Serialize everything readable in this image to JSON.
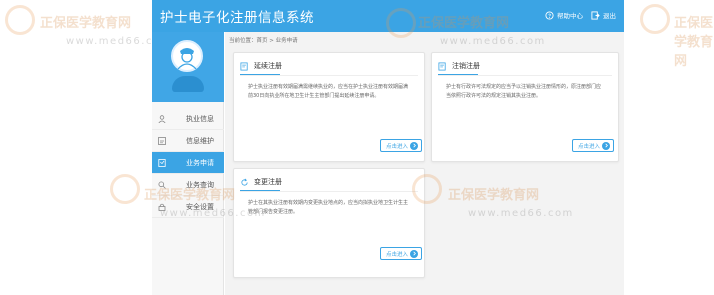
{
  "header": {
    "title": "护士电子化注册信息系统",
    "help_label": "帮助中心",
    "logout_label": "退出"
  },
  "sidebar": {
    "items": [
      {
        "label": "执业信息",
        "icon": "user-icon",
        "active": false
      },
      {
        "label": "信息维护",
        "icon": "edit-icon",
        "active": false
      },
      {
        "label": "业务申请",
        "icon": "document-icon",
        "active": true
      },
      {
        "label": "业务查询",
        "icon": "search-icon",
        "active": false
      },
      {
        "label": "安全设置",
        "icon": "lock-icon",
        "active": false
      }
    ]
  },
  "breadcrumb": "当前位置：首页 > 业务申请",
  "cards": {
    "renew": {
      "title": "延续注册",
      "description": "护士执业注册有效期届满需继续执业的，应当在护士执业注册有效期届满前30日向执业所在地卫生计生主管部门提出延续注册申请。",
      "button": "点击进入"
    },
    "cancel": {
      "title": "注销注册",
      "description": "护士有行政许可法规定的应当予以注销执业注册情形的，原注册部门应当依照行政许可法的规定注销其执业注册。",
      "button": "点击进入"
    },
    "change": {
      "title": "变更注册",
      "description": "护士在其执业注册有效期内变更执业地点的，应当向拟执业地卫生计生主管部门报告变更注册。",
      "button": "点击进入"
    }
  },
  "watermarks": {
    "brand": "正保医学教育网",
    "url": "www.med66.com"
  },
  "colors": {
    "accent": "#3ba4e4",
    "watermark": "#e0a070"
  }
}
